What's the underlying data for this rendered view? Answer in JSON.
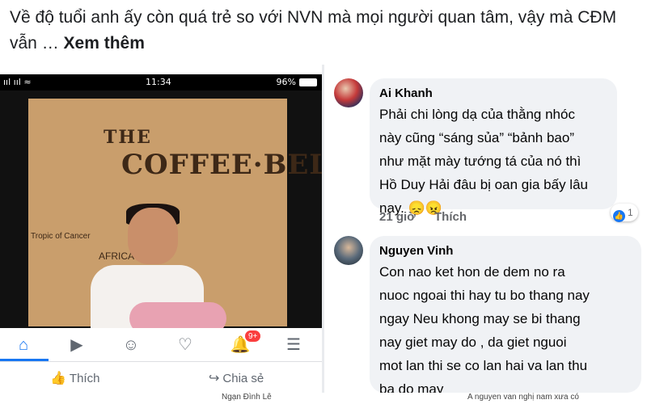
{
  "post": {
    "text": "Về độ tuổi anh ấy còn quá trẻ so với NVN mà mọi người quan tâm, vậy mà CĐM vẫn … ",
    "more_label": "Xem thêm"
  },
  "phone": {
    "status": {
      "signal": "ııl ııl ≈",
      "time": "11:34",
      "battery": "96%"
    },
    "photo": {
      "sign_the": "THE",
      "sign_main": "COFFEE·BELT",
      "map_label_1": "Tropic of Cancer",
      "map_label_2": "AFRICA"
    },
    "nav": {
      "items": [
        {
          "icon": "home-icon",
          "glyph": "⌂"
        },
        {
          "icon": "video-icon",
          "glyph": "▶"
        },
        {
          "icon": "groups-icon",
          "glyph": "☺"
        },
        {
          "icon": "dating-heart-icon",
          "glyph": "♡"
        },
        {
          "icon": "bell-icon",
          "glyph": "🔔"
        },
        {
          "icon": "menu-icon",
          "glyph": "☰"
        }
      ],
      "notification_count": "9+"
    },
    "actions": {
      "like_label": "Thích",
      "share_label": "Chia sẻ"
    }
  },
  "comments": [
    {
      "author": "Ai Khanh",
      "text": "Phải chi lòng dạ của thằng nhóc\nnày cũng “sáng sủa” “bảnh bao”\nnhư mặt mày tướng tá của nó thì\nHồ Duy Hải đâu bị oan gia bấy lâu\nnay. 😞😠",
      "time": "21 giờ",
      "like_label": "Thích",
      "reaction_count": "1"
    },
    {
      "author": "Nguyen Vinh",
      "text": "Con nao ket hon de dem no ra\nnuoc ngoai thi hay tu bo thang nay\nngay   Neu khong may se bi thang\nnay giet may do , da giet nguoi\nmot lan thi se co lan hai va lan thu\nba do may"
    }
  ],
  "bottom_strip": {
    "name_cut": "Ngạn Đình Lê",
    "text_cut": "A nguyen van nghị nam xưa có"
  },
  "colors": {
    "accent": "#1877f2",
    "badge": "#fa3e3e",
    "bubble": "#f0f2f5"
  }
}
